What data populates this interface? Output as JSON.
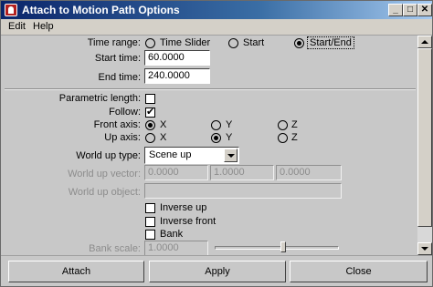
{
  "window": {
    "title": "Attach to Motion Path Options",
    "minimize_glyph": "_",
    "maximize_glyph": "□",
    "close_glyph": "✕"
  },
  "menu": {
    "items": [
      "Edit",
      "Help"
    ]
  },
  "time_range": {
    "label": "Time range:",
    "options": [
      "Time Slider",
      "Start",
      "Start/End"
    ],
    "selected": "Start/End"
  },
  "start_time": {
    "label": "Start time:",
    "value": "60.0000"
  },
  "end_time": {
    "label": "End time:",
    "value": "240.0000"
  },
  "parametric_length": {
    "label": "Parametric length:",
    "checked": false
  },
  "follow": {
    "label": "Follow:",
    "checked": true
  },
  "front_axis": {
    "label": "Front axis:",
    "options": [
      "X",
      "Y",
      "Z"
    ],
    "selected": "X"
  },
  "up_axis": {
    "label": "Up axis:",
    "options": [
      "X",
      "Y",
      "Z"
    ],
    "selected": "Y"
  },
  "world_up_type": {
    "label": "World up type:",
    "value": "Scene up"
  },
  "world_up_vector": {
    "label": "World up vector:",
    "values": [
      "0.0000",
      "1.0000",
      "0.0000"
    ],
    "enabled": false
  },
  "world_up_object": {
    "label": "World up object:",
    "value": "",
    "enabled": false
  },
  "inverse_up": {
    "label": "Inverse up",
    "checked": false
  },
  "inverse_front": {
    "label": "Inverse front",
    "checked": false
  },
  "bank": {
    "label": "Bank",
    "checked": false
  },
  "bank_scale": {
    "label": "Bank scale:",
    "value": "1.0000",
    "enabled": false,
    "slider_fraction": 0.55
  },
  "buttons": {
    "attach": "Attach",
    "apply": "Apply",
    "close": "Close"
  },
  "icons": {
    "app": "maya-app-icon",
    "chevron": "chevron-down-icon"
  }
}
